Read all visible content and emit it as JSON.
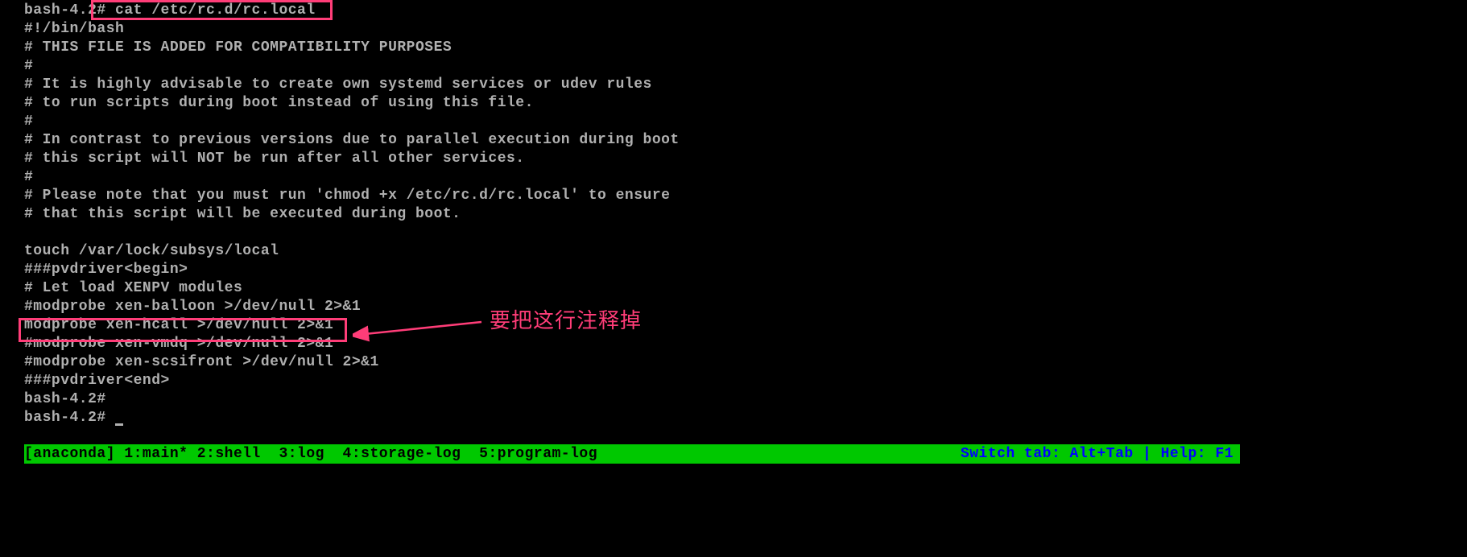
{
  "terminal": {
    "prompt1": "bash-4.2#",
    "command": " cat /etc/rc.d/rc.local",
    "lines": [
      "#!/bin/bash",
      "# THIS FILE IS ADDED FOR COMPATIBILITY PURPOSES",
      "#",
      "# It is highly advisable to create own systemd services or udev rules",
      "# to run scripts during boot instead of using this file.",
      "#",
      "# In contrast to previous versions due to parallel execution during boot",
      "# this script will NOT be run after all other services.",
      "#",
      "# Please note that you must run 'chmod +x /etc/rc.d/rc.local' to ensure",
      "# that this script will be executed during boot.",
      "",
      "touch /var/lock/subsys/local",
      "###pvdriver<begin>",
      "# Let load XENPV modules",
      "#modprobe xen-balloon >/dev/null 2>&1",
      "modprobe xen-hcall >/dev/null 2>&1",
      "#modprobe xen-vmdq >/dev/null 2>&1",
      "#modprobe xen-scsifront >/dev/null 2>&1",
      "###pvdriver<end>"
    ],
    "prompt2": "bash-4.2#",
    "prompt3": "bash-4.2# "
  },
  "annotation": {
    "text": "要把这行注释掉"
  },
  "statusbar": {
    "left": "[anaconda] 1:main* 2:shell  3:log  4:storage-log  5:program-log",
    "right": "Switch tab: Alt+Tab | Help: F1"
  }
}
